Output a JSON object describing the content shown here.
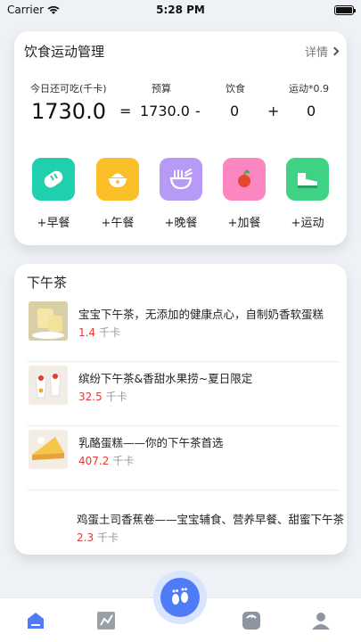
{
  "status_bar": {
    "carrier": "Carrier",
    "time": "5:28 PM",
    "battery_level": 1.0
  },
  "diet_card": {
    "title": "饮食运动管理",
    "detail_label": "详情",
    "labels": {
      "remaining": "今日还可吃(千卡)",
      "budget": "预算",
      "diet": "饮食",
      "exercise": "运动*0.9"
    },
    "values": {
      "remaining": "1730.0",
      "equals": "=",
      "budget": "1730.0",
      "minus": "-",
      "diet": "0",
      "plus": "+",
      "exercise": "0"
    },
    "meals": [
      {
        "label": "+早餐",
        "icon": "bread-icon",
        "color": "#1fcfae"
      },
      {
        "label": "+午餐",
        "icon": "rice-bowl-icon",
        "color": "#fbbf2a"
      },
      {
        "label": "+晚餐",
        "icon": "noodle-bowl-icon",
        "color": "#b79af5"
      },
      {
        "label": "+加餐",
        "icon": "apple-icon",
        "color": "#fb86c0"
      },
      {
        "label": "+运动",
        "icon": "sneaker-icon",
        "color": "#3fd184"
      }
    ]
  },
  "tea_section": {
    "title": "下午茶",
    "kcal_unit": "千卡",
    "items": [
      {
        "title": "宝宝下午茶，无添加的健康点心，自制奶香软蛋糕",
        "kcal": "1.4"
      },
      {
        "title": "缤纷下午茶&香甜水果捞~夏日限定",
        "kcal": "32.5"
      },
      {
        "title": "乳酪蛋糕——你的下午茶首选",
        "kcal": "407.2"
      },
      {
        "title": "鸡蛋土司香蕉卷——宝宝辅食、营养早餐、甜蜜下午茶",
        "kcal": "2.3"
      }
    ]
  },
  "tabbar": {
    "tabs": [
      "home-icon",
      "chart-icon",
      "footprint-icon",
      "scale-icon",
      "profile-icon"
    ],
    "active_color": "#4f7cf6"
  }
}
